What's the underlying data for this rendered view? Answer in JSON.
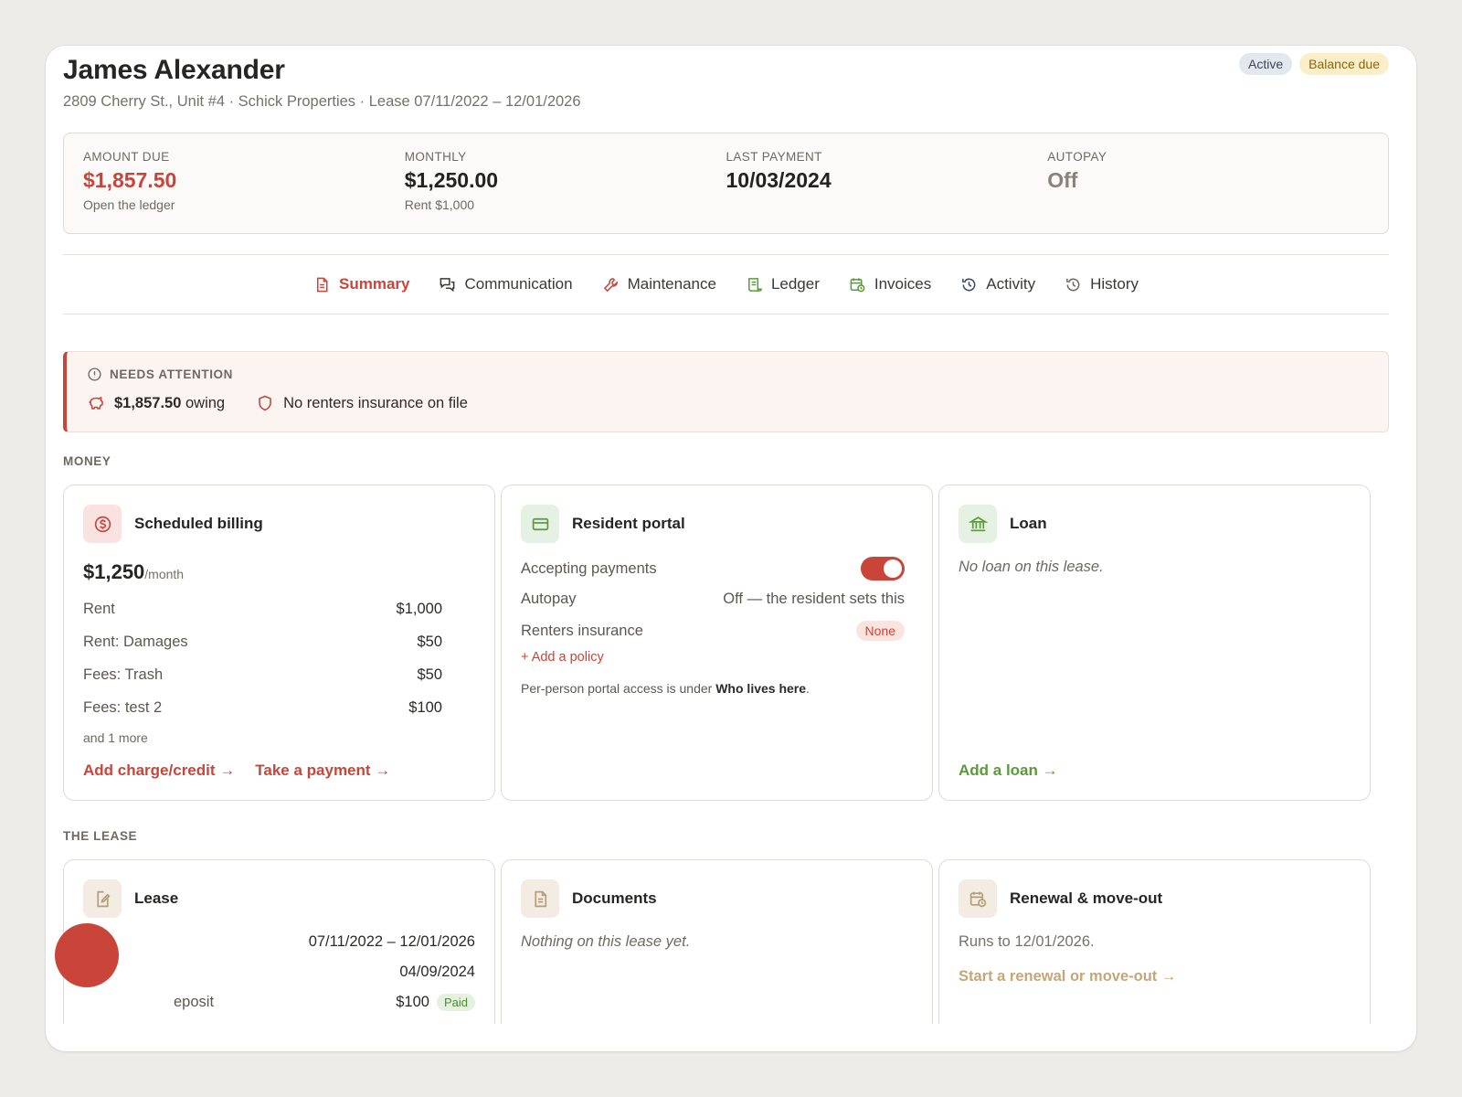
{
  "tenant": {
    "name": "James Alexander",
    "subtitle": "2809 Cherry St., Unit #4 · Schick Properties · Lease 07/11/2022 – 12/01/2026",
    "badges": {
      "active": "Active",
      "balance_due": "Balance due"
    }
  },
  "stats": [
    {
      "label": "AMOUNT DUE",
      "value": "$1,857.50",
      "sub": "Open the ledger"
    },
    {
      "label": "MONTHLY",
      "value": "$1,250.00",
      "sub": "Rent $1,000"
    },
    {
      "label": "LAST PAYMENT",
      "value": "10/03/2024",
      "sub": ""
    },
    {
      "label": "AUTOPAY",
      "value": "Off",
      "sub": ""
    }
  ],
  "tabs": [
    {
      "label": "Summary",
      "icon": "document-icon",
      "active": true
    },
    {
      "label": "Communication",
      "icon": "chat-icon"
    },
    {
      "label": "Maintenance",
      "icon": "wrench-icon"
    },
    {
      "label": "Ledger",
      "icon": "scroll-icon"
    },
    {
      "label": "Invoices",
      "icon": "calendar-clock-icon"
    },
    {
      "label": "Activity",
      "icon": "history-icon"
    },
    {
      "label": "History",
      "icon": "history-icon"
    }
  ],
  "attention": {
    "title": "NEEDS ATTENTION",
    "owing_amount": "$1,857.50",
    "owing_suffix": "owing",
    "insurance": "No renters insurance on file"
  },
  "sections": {
    "money": "MONEY",
    "lease": "THE LEASE"
  },
  "billing": {
    "title": "Scheduled billing",
    "total": "$1,250",
    "per": "/month",
    "rows": [
      {
        "label": "Rent",
        "amount": "$1,000"
      },
      {
        "label": "Rent: Damages",
        "amount": "$50"
      },
      {
        "label": "Fees: Trash",
        "amount": "$50"
      },
      {
        "label": "Fees: test 2",
        "amount": "$100"
      }
    ],
    "more": "and 1 more",
    "add_charge": "Add charge/credit →",
    "take_payment": "Take a payment →"
  },
  "portal": {
    "title": "Resident portal",
    "accepting_label": "Accepting payments",
    "accepting_on": true,
    "autopay_label": "Autopay",
    "autopay_value": "Off — the resident sets this",
    "insurance_label": "Renters insurance",
    "insurance_value": "None",
    "add_policy": "+ Add a policy",
    "note_prefix": "Per-person portal access is under",
    "note_link": "Who lives here",
    "note_suffix": "."
  },
  "loan": {
    "title": "Loan",
    "empty": "No loan on this lease.",
    "add": "Add a loan →"
  },
  "lease": {
    "title": "Lease",
    "term": "07/11/2022 – 12/01/2026",
    "signed": "04/09/2024",
    "deposit_label": "eposit",
    "deposit_value": "$100",
    "deposit_status": "Paid"
  },
  "documents": {
    "title": "Documents",
    "empty": "Nothing on this lease yet."
  },
  "renewal": {
    "title": "Renewal & move-out",
    "runs_to": "Runs to 12/01/2026.",
    "link": "Start a renewal or move-out →"
  },
  "colors": {
    "accent": "#c9453a",
    "green": "#5a9a3b",
    "tan": "#c4a678"
  }
}
